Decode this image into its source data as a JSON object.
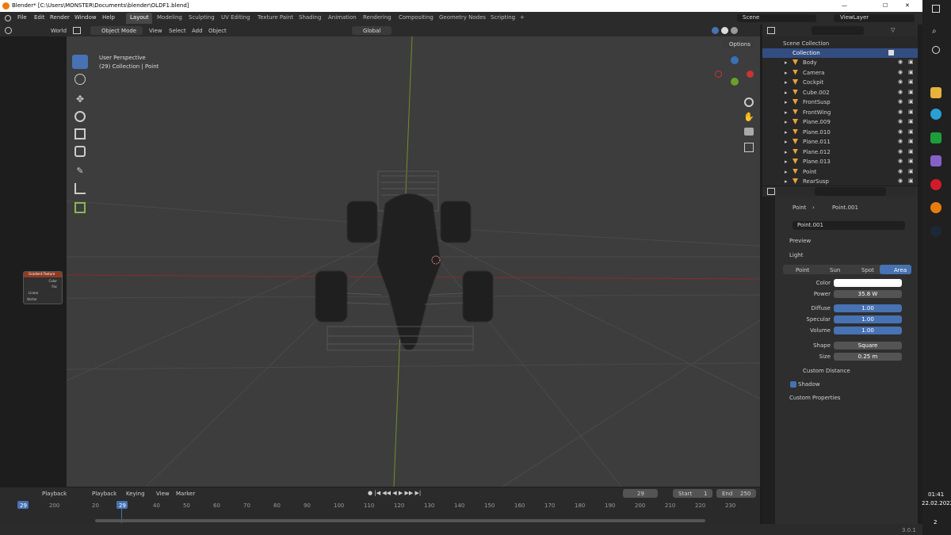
{
  "window": {
    "title": "Blender* [C:\\Users\\MONSTER\\Documents\\blender\\OLDF1.blend]",
    "min": "—",
    "max": "☐",
    "close": "✕"
  },
  "menu": [
    "File",
    "Edit",
    "Render",
    "Window",
    "Help"
  ],
  "workspaces": [
    "Layout",
    "Modeling",
    "Sculpting",
    "UV Editing",
    "Texture Paint",
    "Shading",
    "Animation",
    "Rendering",
    "Compositing",
    "Geometry Nodes",
    "Scripting"
  ],
  "active_workspace": "Layout",
  "scene": {
    "label": "Scene",
    "viewlayer": "ViewLayer"
  },
  "viewport_header": {
    "mode": "Object Mode",
    "menus": [
      "View",
      "Select",
      "Add",
      "Object"
    ],
    "orientation": "Global",
    "options": "Options"
  },
  "viewport": {
    "perspective": "User Perspective",
    "collection": "(29) Collection | Point"
  },
  "left_panel": {
    "world": "World",
    "node_title": "Gradient Texture",
    "outputs": [
      "Color",
      "Fac"
    ],
    "dropdown": "Linear",
    "input": "Vector"
  },
  "outliner": {
    "root": "Scene Collection",
    "collection": "Collection",
    "items": [
      "Body",
      "Camera",
      "Cockpit",
      "Cube.002",
      "FrontSusp",
      "FrontWing",
      "Plane.009",
      "Plane.010",
      "Plane.011",
      "Plane.012",
      "Plane.013",
      "Point",
      "RearSusp"
    ]
  },
  "properties": {
    "breadcrumb": [
      "Point",
      "Point.001"
    ],
    "datablock": "Point.001",
    "sections": {
      "preview": "Preview",
      "light": "Light",
      "custom_distance": "Custom Distance",
      "shadow": "Shadow",
      "custom_properties": "Custom Properties"
    },
    "light_types": [
      "Point",
      "Sun",
      "Spot",
      "Area"
    ],
    "active_light_type": "Area",
    "rows": [
      {
        "label": "Color",
        "value": ""
      },
      {
        "label": "Power",
        "value": "35.8 W"
      },
      {
        "label": "Diffuse",
        "value": "1.00"
      },
      {
        "label": "Specular",
        "value": "1.00"
      },
      {
        "label": "Volume",
        "value": "1.00"
      },
      {
        "label": "Shape",
        "value": "Square"
      },
      {
        "label": "Size",
        "value": "0.25 m"
      }
    ]
  },
  "timeline": {
    "header": [
      "Playback",
      "Keying",
      "View",
      "Marker"
    ],
    "left_header": "Playback",
    "current_frame": "29",
    "start_label": "Start",
    "start": "1",
    "end_label": "End",
    "end": "250",
    "ticks": [
      "20",
      "40",
      "50",
      "60",
      "70",
      "80",
      "90",
      "100",
      "110",
      "120",
      "130",
      "140",
      "150",
      "160",
      "170",
      "180",
      "190",
      "200",
      "210",
      "220",
      "230"
    ],
    "left_ticks": [
      "29",
      "200"
    ],
    "playhead": "29"
  },
  "status": {
    "version": "3.0.1"
  },
  "taskbar": {
    "time": "01:41",
    "date": "22.02.2022",
    "notif": "2"
  },
  "colors": {
    "accent": "#4772b3",
    "active_frame": "#4772b3",
    "x_axis": "#8a2b2b",
    "y_axis": "#6f8f2a"
  }
}
